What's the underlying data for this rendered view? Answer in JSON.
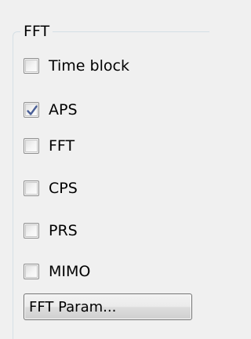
{
  "group": {
    "title": "FFT",
    "options": [
      {
        "label": "Time block",
        "checked": false
      },
      {
        "label": "APS",
        "checked": true
      },
      {
        "label": "FFT",
        "checked": false
      },
      {
        "label": "CPS",
        "checked": false
      },
      {
        "label": "PRS",
        "checked": false
      },
      {
        "label": "MIMO",
        "checked": false
      }
    ],
    "button_label": "FFT Param..."
  },
  "colors": {
    "background": "#f0f0f0",
    "checkmark": "#4a5f97",
    "group_border": "#d5dfe5"
  },
  "icons": {
    "checkmark": "checkmark-icon"
  }
}
